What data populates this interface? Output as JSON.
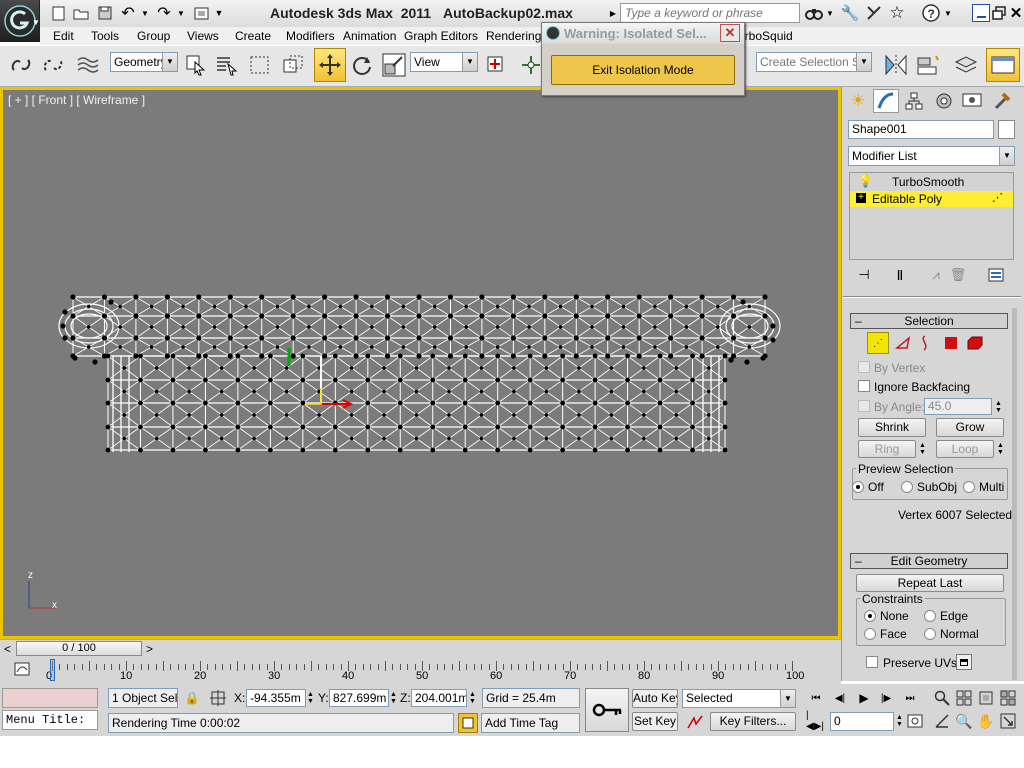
{
  "title_bar": {
    "app_title": "Autodesk 3ds Max  2011",
    "file_name": "AutoBackup02.max",
    "search_placeholder": "Type a keyword or phrase"
  },
  "menu": {
    "items": [
      "Edit",
      "Tools",
      "Group",
      "Views",
      "Create",
      "Modifiers",
      "Animation",
      "Graph Editors",
      "Rendering",
      "TurboSquid"
    ],
    "turbosquid_visible": "urboSquid"
  },
  "toolbar": {
    "selection_filter": "Geometry",
    "reference_coord": "View",
    "named_selection_placeholder": "Create Selection Se"
  },
  "warning_dialog": {
    "title": "Warning: Isolated Sel...",
    "button": "Exit Isolation Mode"
  },
  "viewport": {
    "label": "[ + ] [ Front ] [ Wireframe ]",
    "axis_z": "z",
    "axis_x": "x"
  },
  "command_panel": {
    "object_name": "Shape001",
    "modifier_list": "Modifier List",
    "stack": [
      {
        "label": "TurboSmooth",
        "selected": false
      },
      {
        "label": "Editable Poly",
        "selected": true
      }
    ],
    "selection": {
      "header": "Selection",
      "by_vertex": "By Vertex",
      "ignore_backfacing": "Ignore Backfacing",
      "by_angle": "By Angle:",
      "angle_value": "45.0",
      "shrink": "Shrink",
      "grow": "Grow",
      "ring": "Ring",
      "loop": "Loop",
      "preview_group": "Preview Selection",
      "preview_off": "Off",
      "preview_subobj": "SubObj",
      "preview_multi": "Multi",
      "status": "Vertex 6007 Selected"
    },
    "edit_geometry": {
      "header": "Edit Geometry",
      "repeat_last": "Repeat Last",
      "constraints": "Constraints",
      "none": "None",
      "edge": "Edge",
      "face": "Face",
      "normal": "Normal",
      "preserve_uvs": "Preserve UVs"
    }
  },
  "timeline": {
    "frame_display": "0 / 100",
    "prev": "<",
    "next": ">",
    "ticks": [
      "0",
      "10",
      "20",
      "30",
      "40",
      "50",
      "60",
      "70",
      "80",
      "90",
      "100"
    ]
  },
  "status_bar": {
    "maxscript_label": "Menu Title:",
    "selection_info": "1 Object Sele",
    "x_label": "X:",
    "x_value": "-94.355m",
    "y_label": "Y:",
    "y_value": "827.699m",
    "z_label": "Z:",
    "z_value": "204.001m",
    "grid": "Grid = 25.4m",
    "rendering_time": "Rendering Time  0:00:02",
    "add_time_tag": "Add Time Tag",
    "auto_key": "Auto Key",
    "set_key": "Set Key",
    "key_mode": "Selected",
    "key_filters": "Key Filters...",
    "current_frame": "0"
  }
}
